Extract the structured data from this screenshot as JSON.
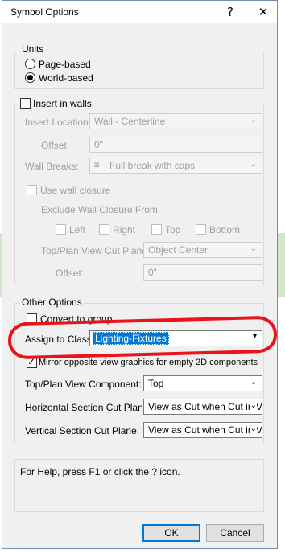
{
  "dialog": {
    "title": "Symbol Options",
    "help_button": "?",
    "close_button": "✕"
  },
  "units": {
    "label": "Units",
    "options": [
      "Page-based",
      "World-based"
    ],
    "selected": "World-based"
  },
  "insert_in_walls": {
    "label": "Insert in walls",
    "checked": false,
    "insert_location_label": "Insert Location:",
    "insert_location_value": "Wall - Centerline",
    "offset_label": "Offset:",
    "offset_value": "0\"",
    "wall_breaks_label": "Wall Breaks:",
    "wall_breaks_value": "Full break with caps",
    "use_wall_closure_label": "Use wall closure",
    "exclude_label": "Exclude Wall Closure From:",
    "exclude_options": [
      "Left",
      "Right",
      "Top",
      "Bottom"
    ],
    "cut_plane_label": "Top/Plan View Cut Plane:",
    "cut_plane_value": "Object Center",
    "offset2_label": "Offset:",
    "offset2_value": "0\""
  },
  "other_options": {
    "label": "Other Options",
    "convert_to_group_label": "Convert to group",
    "convert_checked": false,
    "assign_class_label": "Assign to Class:",
    "assign_class_value": "Lighting-Fixtures",
    "mirror_label": "Mirror opposite view graphics for empty 2D components",
    "mirror_checked": true,
    "top_plan_label": "Top/Plan View Component:",
    "top_plan_value": "Top",
    "horizontal_label": "Horizontal Section Cut Plane:",
    "horizontal_value": "View as Cut when Cut in V",
    "vertical_label": "Vertical Section Cut Plane:",
    "vertical_value": "View as Cut when Cut in V"
  },
  "help_text": "For Help, press F1 or click the ? icon.",
  "buttons": {
    "ok": "OK",
    "cancel": "Cancel"
  },
  "colors": {
    "accent": "#0078d7",
    "annotation": "#e8141c"
  }
}
